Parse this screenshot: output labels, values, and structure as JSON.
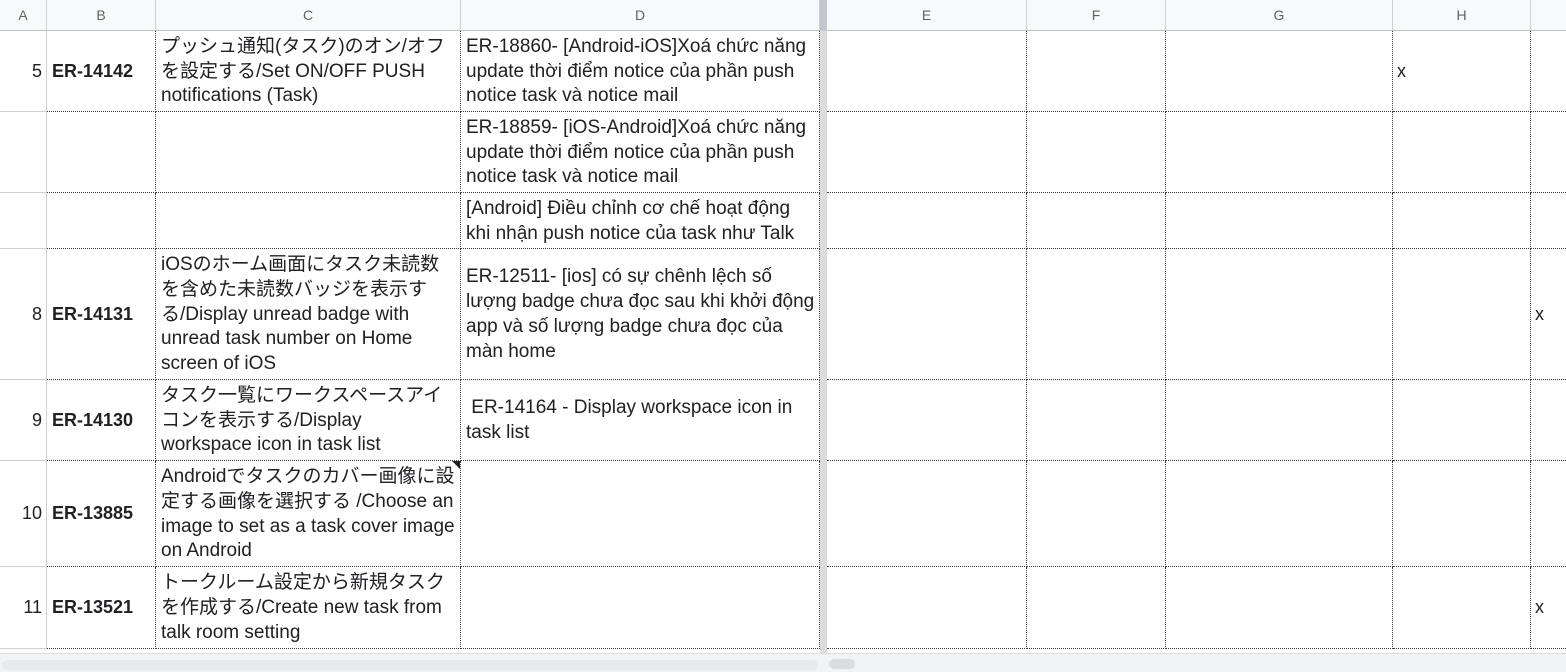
{
  "columns": [
    "A",
    "B",
    "C",
    "D",
    "E",
    "F",
    "G",
    "H"
  ],
  "rows": [
    {
      "num": "5",
      "id": "ER-14142",
      "title": "プッシュ通知(タスク)のオン/オフを設定する/Set ON/OFF PUSH notifications (Task)",
      "sub": "ER-18860- [Android-iOS]Xoá chức năng update thời điểm notice của phần push notice task và notice mail",
      "h": "x",
      "i": ""
    },
    {
      "num": "",
      "id": "",
      "title": "",
      "sub": "ER-18859- [iOS-Android]Xoá chức năng update thời điểm notice của phần push notice task và notice mail",
      "h": "",
      "i": ""
    },
    {
      "num": "",
      "id": "",
      "title": "",
      "sub": "[Android] Điều chỉnh cơ chế hoạt động khi nhận push notice của task như Talk",
      "h": "",
      "i": ""
    },
    {
      "num": "8",
      "id": "ER-14131",
      "title": "iOSのホーム画面にタスク未読数を含めた未読数バッジを表示する/Display unread badge with unread task number on Home screen of iOS",
      "sub": "ER-12511- [ios] có sự chênh lệch số lượng badge chưa đọc sau khi khởi động app và số lượng badge chưa đọc của màn home",
      "h": "",
      "i": "x"
    },
    {
      "num": "9",
      "id": "ER-14130",
      "title": "タスク一覧にワークスペースアイコンを表示する/Display workspace icon in task list",
      "sub": " ER-14164 - Display workspace icon in task list",
      "h": "",
      "i": ""
    },
    {
      "num": "10",
      "id": "ER-13885",
      "title": "Androidでタスクのカバー画像に設定する画像を選択する /Choose an image to set as a task cover image on Android",
      "sub": "",
      "h": "",
      "i": ""
    },
    {
      "num": "11",
      "id": "ER-13521",
      "title": "トークルーム設定から新規タスクを作成する/Create new task from talk room setting",
      "sub": "",
      "h": "",
      "i": "x"
    }
  ]
}
